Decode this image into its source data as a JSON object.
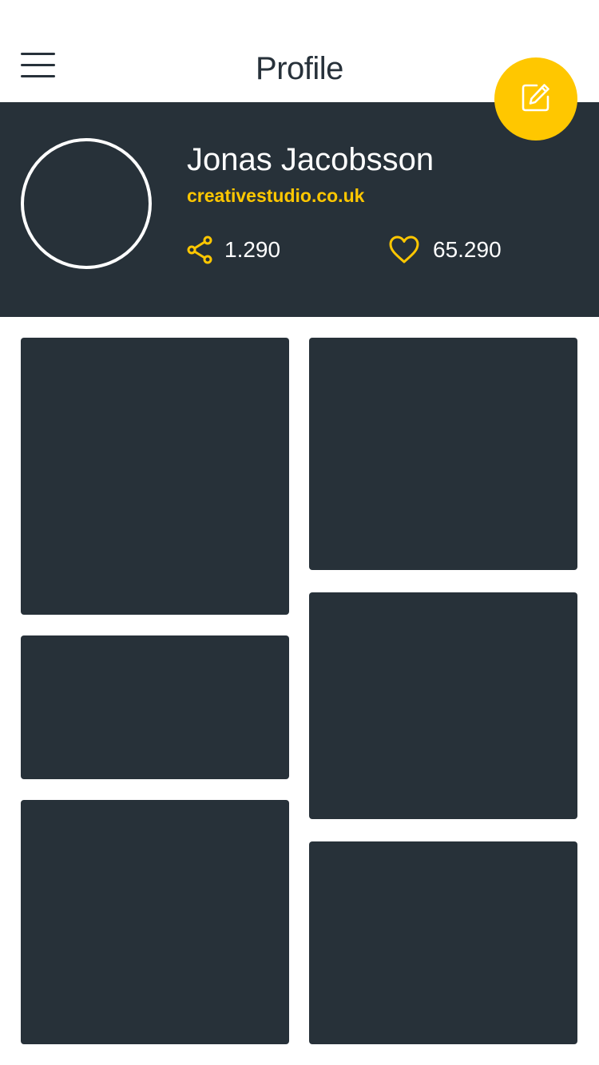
{
  "header": {
    "title": "Profile",
    "menu_icon": "hamburger-menu-icon",
    "edit_icon": "edit-icon"
  },
  "profile": {
    "name": "Jonas Jacobsson",
    "website": "creativestudio.co.uk",
    "shares": "1.290",
    "likes": "65.290",
    "share_icon": "share-icon",
    "heart_icon": "heart-icon"
  },
  "gallery": {
    "tile_count": 6
  },
  "colors": {
    "accent": "#ffc700",
    "dark": "#273139",
    "background": "#ffffff"
  }
}
